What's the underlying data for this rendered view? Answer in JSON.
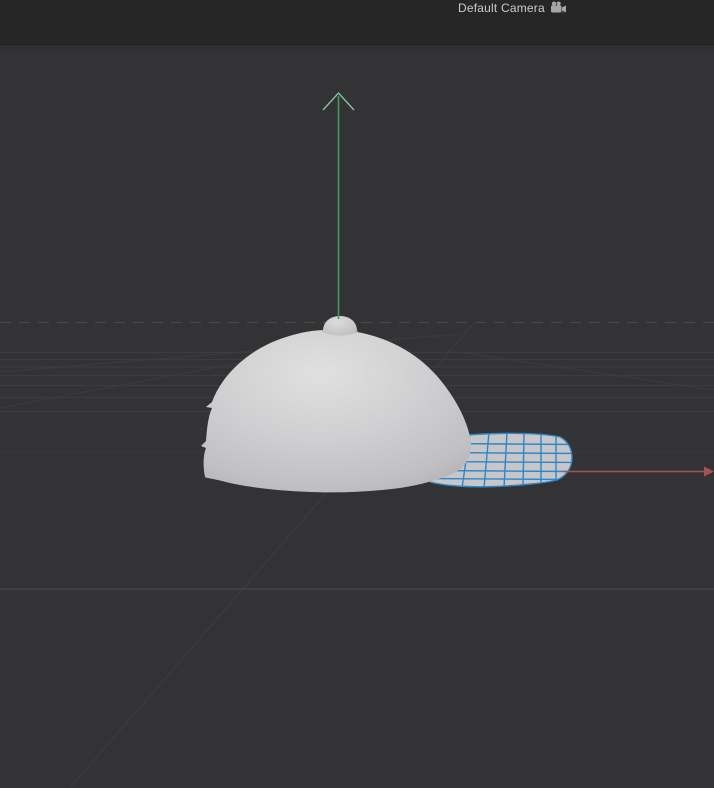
{
  "topbar": {
    "camera_label": "Default Camera",
    "camera_icon": "camera-icon"
  },
  "colors": {
    "topbar_bg": "#262626",
    "viewport_bg": "#333234",
    "label_text": "#cbcbcb",
    "icon_gray": "#a6a6a6",
    "grid_line": "#3d3d3f",
    "grid_bright": "#4d4d4f",
    "horizon": "#49494b",
    "axis_y": "#3f9d62",
    "axis_y_head": "#84c49d",
    "axis_x": "#a75252",
    "selection_blue": "#2e86c8",
    "patch_fill": "#c7c6c9",
    "dome_light": "#e0e0e0",
    "dome_mid": "#cfcfd1",
    "dome_edge": "#aaaaac",
    "knob_light": "#dcdcdc",
    "knob_edge": "#b9b9bb"
  }
}
